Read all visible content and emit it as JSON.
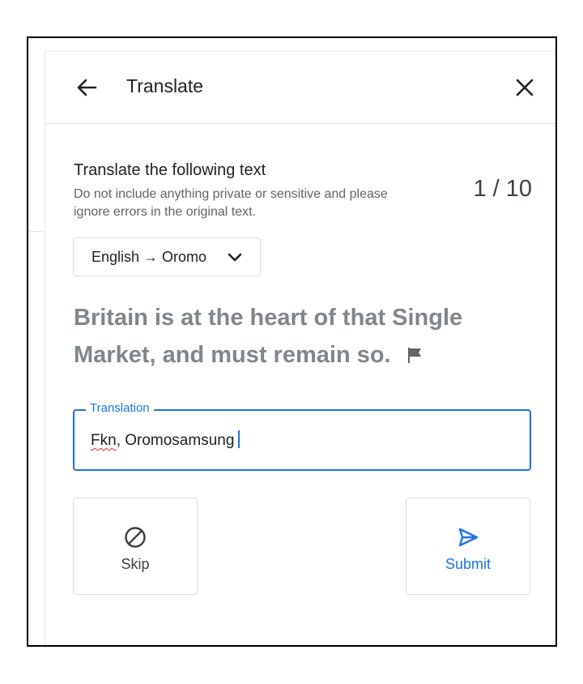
{
  "header": {
    "back_icon": "arrow-left-icon",
    "title": "Translate",
    "close_icon": "close-icon"
  },
  "task": {
    "title": "Translate the following text",
    "description": "Do not include anything private or sensitive and please ignore errors in the original text.",
    "counter": "1 / 10"
  },
  "language_select": {
    "value": "English → Oromo",
    "icon": "chevron-down-icon"
  },
  "source": {
    "text": "Britain is at the heart of that Single Market, and must remain so.",
    "flag_icon": "flag-icon"
  },
  "translation": {
    "label": "Translation",
    "value_misspelled": "Fkn",
    "value_rest": ", Oromosamsung"
  },
  "actions": {
    "skip_label": "Skip",
    "skip_icon": "block-icon",
    "submit_label": "Submit",
    "submit_icon": "send-icon"
  },
  "colors": {
    "accent": "#1a73e8",
    "muted_text": "#80868b",
    "border": "#dadce0",
    "spelling_error": "#d93025"
  }
}
